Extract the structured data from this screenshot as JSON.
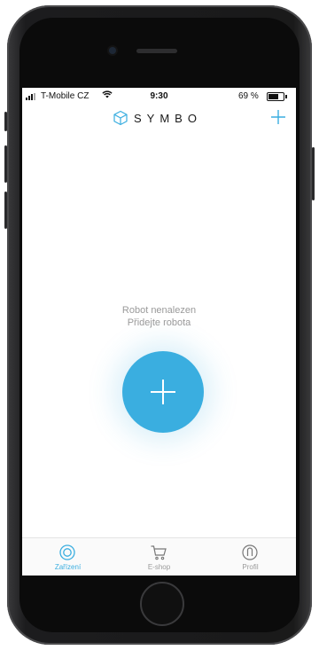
{
  "status_bar": {
    "carrier": "T-Mobile CZ",
    "time": "9:30",
    "battery_percent": "69 %",
    "battery_level": 0.69
  },
  "header": {
    "logo_text": "SYMBO",
    "logo_icon": "cube-icon",
    "add_icon": "plus-icon"
  },
  "empty_state": {
    "title": "Robot nenalezen",
    "subtitle": "Přidejte robota"
  },
  "fab": {
    "icon": "plus-icon"
  },
  "colors": {
    "accent": "#3aaee0",
    "muted_text": "#9a9a9a",
    "text": "#1a1a1a"
  },
  "tabbar": {
    "items": [
      {
        "label": "Zařízení",
        "icon": "robot-vacuum-icon",
        "active": true
      },
      {
        "label": "E-shop",
        "icon": "cart-icon",
        "active": false
      },
      {
        "label": "Profil",
        "icon": "profile-icon",
        "active": false
      }
    ]
  }
}
